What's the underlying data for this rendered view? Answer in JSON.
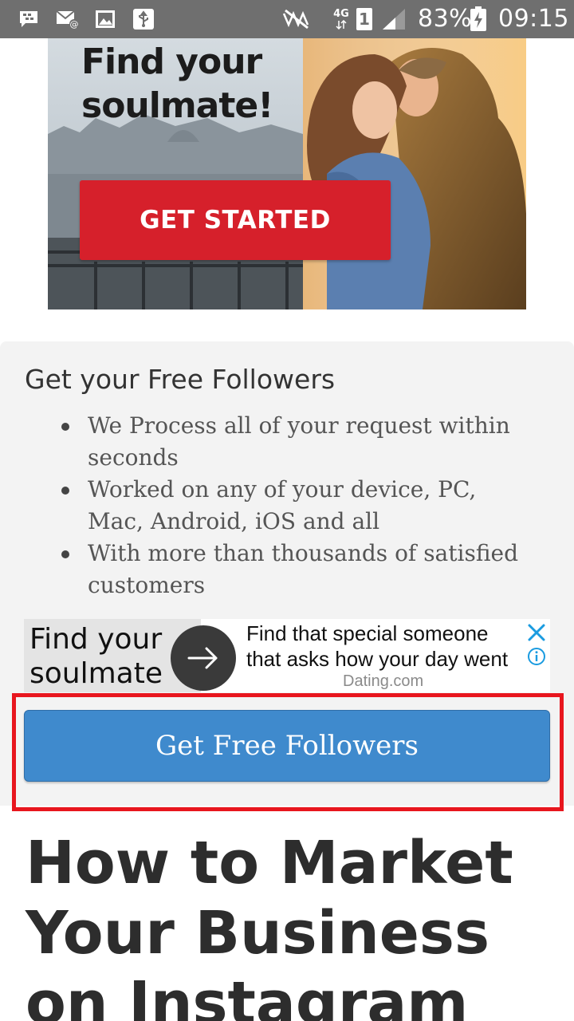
{
  "status_bar": {
    "battery": "83%",
    "time": "09:15",
    "network": "4G",
    "sim_slot": "1",
    "icons": [
      "bbm-icon",
      "mail-icon",
      "image-icon",
      "usb-icon",
      "mute-icon",
      "network-4g-icon",
      "sim-icon",
      "signal-icon",
      "battery-charging-icon"
    ]
  },
  "banner_ad": {
    "headline": "Find your soulmate!",
    "cta_label": "GET STARTED",
    "cta_color": "#d6202b"
  },
  "followers_card": {
    "title": "Get your Free Followers",
    "features": [
      "We Process all of your request within seconds",
      "Worked on any of your device, PC, Mac, Android, iOS and all",
      "With more than thousands of satisfied customers"
    ],
    "button_label": "Get Free Followers",
    "button_color": "#3f8acd",
    "highlight_color": "#e8161e"
  },
  "native_ad": {
    "thumb_text": "Find your soulmate",
    "line1": "Find that special someone",
    "line2": "that asks how your day went",
    "source": "Dating.com",
    "icons": [
      "arrow-right-icon",
      "close-icon",
      "info-icon"
    ]
  },
  "article": {
    "title": "How to Market Your Business on Instagram"
  }
}
